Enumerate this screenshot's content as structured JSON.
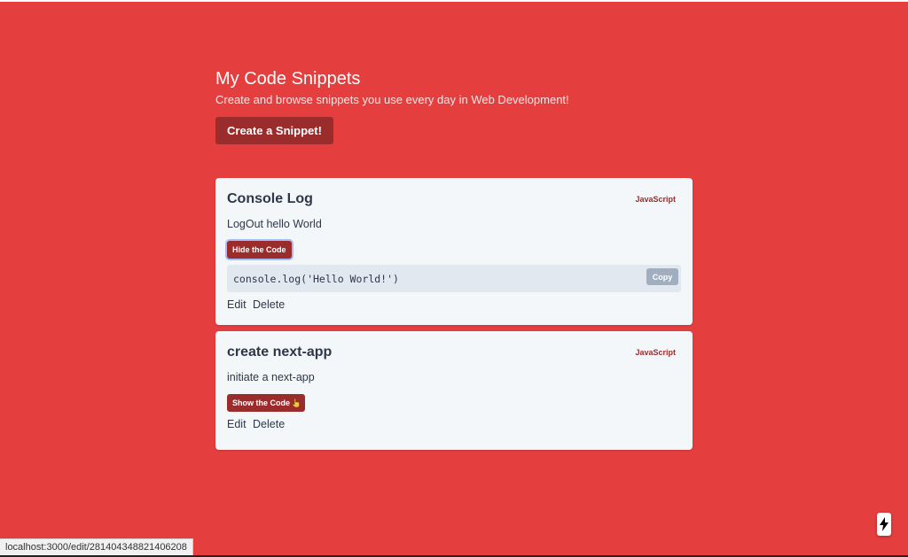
{
  "header": {
    "title": "My Code Snippets",
    "subtitle": "Create and browse snippets you use every day in Web Development!",
    "create_label": "Create a Snippet!"
  },
  "snippets": [
    {
      "title": "Console Log",
      "language": "JavaScript",
      "description": "LogOut hello World",
      "toggle_label": "Hide the Code",
      "code": "console.log('Hello World!')",
      "copy_label": "Copy",
      "edit_label": "Edit",
      "delete_label": "Delete"
    },
    {
      "title": "create next-app",
      "language": "JavaScript",
      "description": "initiate a next-app",
      "toggle_label": "Show the Code",
      "edit_label": "Edit",
      "delete_label": "Delete"
    }
  ],
  "status_bar": {
    "url": "localhost:3000/edit/281404348821406208"
  },
  "icons": {
    "pointer": "pointer-hand-icon",
    "next_indicator": "lightning-bolt-icon"
  },
  "colors": {
    "background": "#e53e3e",
    "primary_button": "#9b2c2c",
    "card": "#f4f7fa",
    "code_bg": "#e2e8f0",
    "copy_button": "#a0aec0"
  }
}
